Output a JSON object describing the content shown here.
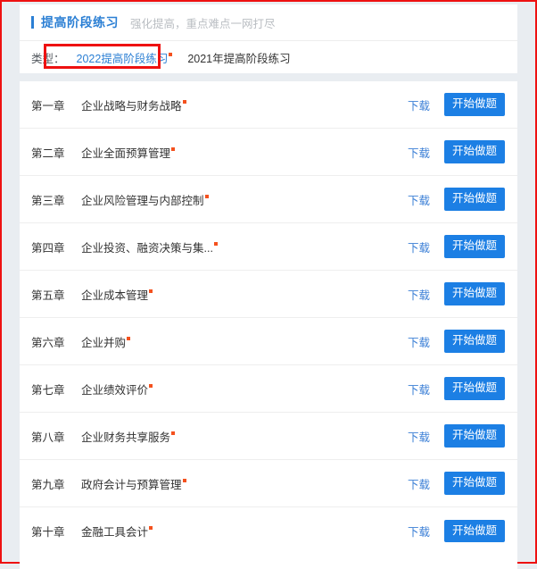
{
  "header": {
    "title": "提高阶段练习",
    "subtitle": "强化提高，重点难点一网打尽",
    "accent_color": "#2b7fd4"
  },
  "filter": {
    "label": "类型：",
    "tabs": [
      {
        "label": "2022提高阶段练习",
        "active": true,
        "badge": true
      },
      {
        "label": "2021年提高阶段练习",
        "active": false,
        "badge": false
      }
    ]
  },
  "annotation": {
    "color": "#ee1111",
    "target": "2022提高阶段练习"
  },
  "list": {
    "download_label": "下载",
    "start_label": "开始做题",
    "button_color": "#1c7fe4",
    "link_color": "#3b7fd6",
    "badge_color": "#f4511e",
    "rows": [
      {
        "chapter": "第一章",
        "title": "企业战略与财务战略",
        "badge": true
      },
      {
        "chapter": "第二章",
        "title": "企业全面预算管理",
        "badge": true
      },
      {
        "chapter": "第三章",
        "title": "企业风险管理与内部控制",
        "badge": true
      },
      {
        "chapter": "第四章",
        "title": "企业投资、融资决策与集...",
        "badge": true
      },
      {
        "chapter": "第五章",
        "title": "企业成本管理",
        "badge": true
      },
      {
        "chapter": "第六章",
        "title": "企业并购",
        "badge": true
      },
      {
        "chapter": "第七章",
        "title": "企业绩效评价",
        "badge": true
      },
      {
        "chapter": "第八章",
        "title": "企业财务共享服务",
        "badge": true
      },
      {
        "chapter": "第九章",
        "title": "政府会计与预算管理",
        "badge": true
      },
      {
        "chapter": "第十章",
        "title": "金融工具会计",
        "badge": true
      }
    ]
  }
}
